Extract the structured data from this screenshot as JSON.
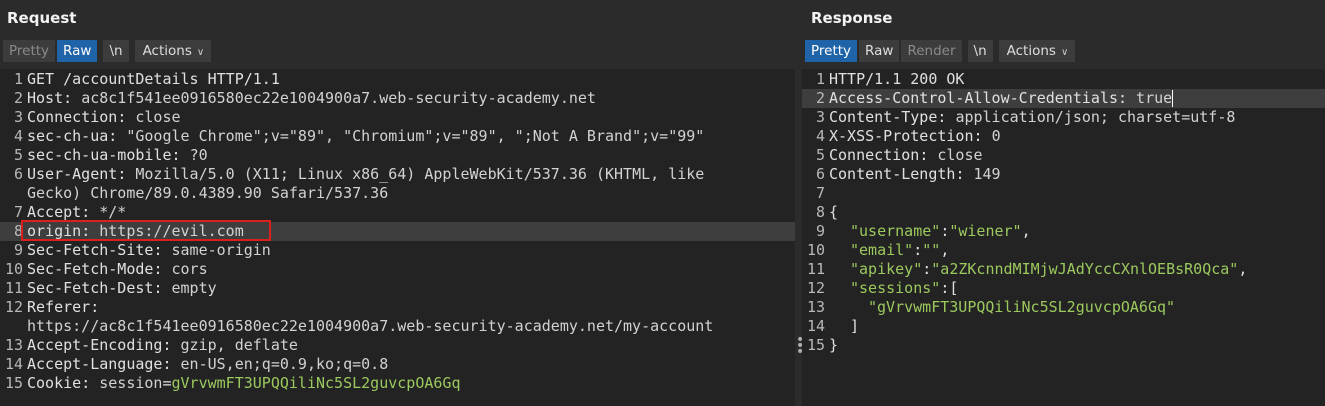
{
  "request": {
    "title": "Request",
    "tabs": {
      "pretty": "Pretty",
      "raw": "Raw",
      "newline": "\\n",
      "actions": "Actions"
    },
    "lines": [
      {
        "n": "1",
        "text": "GET /accountDetails HTTP/1.1"
      },
      {
        "n": "2",
        "key": "Host",
        "value": "ac8c1f541ee0916580ec22e1004900a7.web-security-academy.net"
      },
      {
        "n": "3",
        "key": "Connection",
        "value": "close"
      },
      {
        "n": "4",
        "key": "sec-ch-ua",
        "value": "\"Google Chrome\";v=\"89\", \"Chromium\";v=\"89\", \";Not A Brand\";v=\"99\""
      },
      {
        "n": "5",
        "key": "sec-ch-ua-mobile",
        "value": "?0"
      },
      {
        "n": "6",
        "key": "User-Agent",
        "value": "Mozilla/5.0 (X11; Linux x86_64) AppleWebKit/537.36 (KHTML, like"
      },
      {
        "n": "",
        "text": "Gecko) Chrome/89.0.4389.90 Safari/537.36"
      },
      {
        "n": "7",
        "key": "Accept",
        "value": "*/*"
      },
      {
        "n": "8",
        "key": "origin",
        "value": "https://evil.com"
      },
      {
        "n": "9",
        "key": "Sec-Fetch-Site",
        "value": "same-origin"
      },
      {
        "n": "10",
        "key": "Sec-Fetch-Mode",
        "value": "cors"
      },
      {
        "n": "11",
        "key": "Sec-Fetch-Dest",
        "value": "empty"
      },
      {
        "n": "12",
        "text": "Referer:"
      },
      {
        "n": "",
        "text": "https://ac8c1f541ee0916580ec22e1004900a7.web-security-academy.net/my-account"
      },
      {
        "n": "13",
        "key": "Accept-Encoding",
        "value": "gzip, deflate"
      },
      {
        "n": "14",
        "key": "Accept-Language",
        "value": "en-US,en;q=0.9,ko;q=0.8"
      },
      {
        "n": "15",
        "key": "Cookie",
        "cookie_name": "session",
        "cookie_value": "gVrvwmFT3UPQQiliNc5SL2guvcpOA6Gq"
      }
    ]
  },
  "response": {
    "title": "Response",
    "tabs": {
      "pretty": "Pretty",
      "raw": "Raw",
      "render": "Render",
      "newline": "\\n",
      "actions": "Actions"
    },
    "lines": [
      {
        "n": "1",
        "text": "HTTP/1.1 200 OK"
      },
      {
        "n": "2",
        "key": "Access-Control-Allow-Credentials",
        "value": "true"
      },
      {
        "n": "3",
        "key": "Content-Type",
        "value": "application/json; charset=utf-8"
      },
      {
        "n": "4",
        "key": "X-XSS-Protection",
        "value": "0"
      },
      {
        "n": "5",
        "key": "Connection",
        "value": "close"
      },
      {
        "n": "6",
        "key": "Content-Length",
        "value": "149"
      },
      {
        "n": "7",
        "text": ""
      },
      {
        "n": "8",
        "text": "{"
      },
      {
        "n": "9",
        "jkey": "\"username\"",
        "jval": "\"wiener\"",
        "tail": ","
      },
      {
        "n": "10",
        "jkey": "\"email\"",
        "jval": "\"\"",
        "tail": ","
      },
      {
        "n": "11",
        "jkey": "\"apikey\"",
        "jval": "\"a2ZKcnndMIMjwJAdYccCXnlOEBsR0Qca\"",
        "tail": ","
      },
      {
        "n": "12",
        "jkey": "\"sessions\"",
        "jval": "",
        "tail": "["
      },
      {
        "n": "13",
        "text": "\"gVrvwmFT3UPQQiliNc5SL2guvcpOA6Gq\""
      },
      {
        "n": "14",
        "text": "]"
      },
      {
        "n": "15",
        "text": "}"
      }
    ]
  }
}
